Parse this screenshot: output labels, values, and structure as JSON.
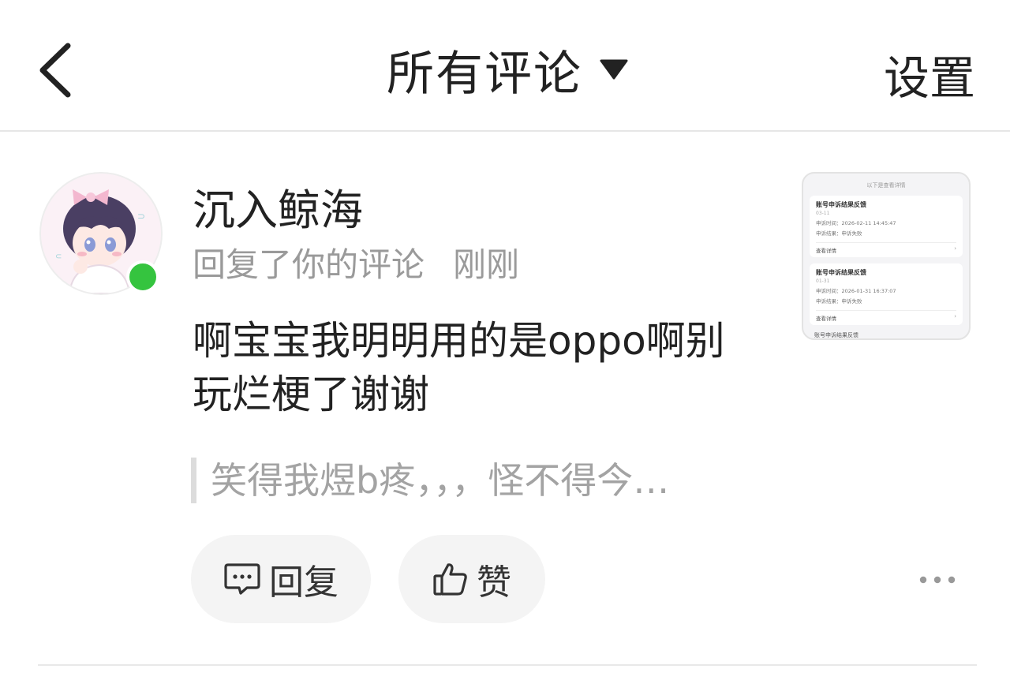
{
  "header": {
    "title": "所有评论",
    "settings_label": "设置"
  },
  "comment": {
    "username": "沉入鲸海",
    "action": "回复了你的评论",
    "time": "刚刚",
    "content_line1": "啊宝宝我明明用的是oppo啊别",
    "content_line2": "玩烂梗了谢谢",
    "quoted": "笑得我煜b疼，，，怪不得今…",
    "online": true,
    "status_color": "#35c43f"
  },
  "actions": {
    "reply_label": "回复",
    "like_label": "赞"
  },
  "thumbnail": {
    "header": "以下是查看详情",
    "cards": [
      {
        "title": "账号申诉结果反馈",
        "date": "03-11",
        "line1": "申诉时间：2026-02-11 14:45:47",
        "line2": "申诉结果：申诉失败",
        "link": "查看详情"
      },
      {
        "title": "账号申诉结果反馈",
        "date": "01-31",
        "line1": "申诉时间：2026-01-31 16:37:07",
        "line2": "申诉结果：申诉失败",
        "link": "查看详情"
      }
    ],
    "cut_title": "账号申诉结果反馈"
  },
  "icons": {
    "back": "chevron-left-icon",
    "dropdown": "caret-down-icon",
    "reply": "comment-bubble-icon",
    "like": "thumbs-up-icon",
    "more": "more-dots-icon"
  }
}
